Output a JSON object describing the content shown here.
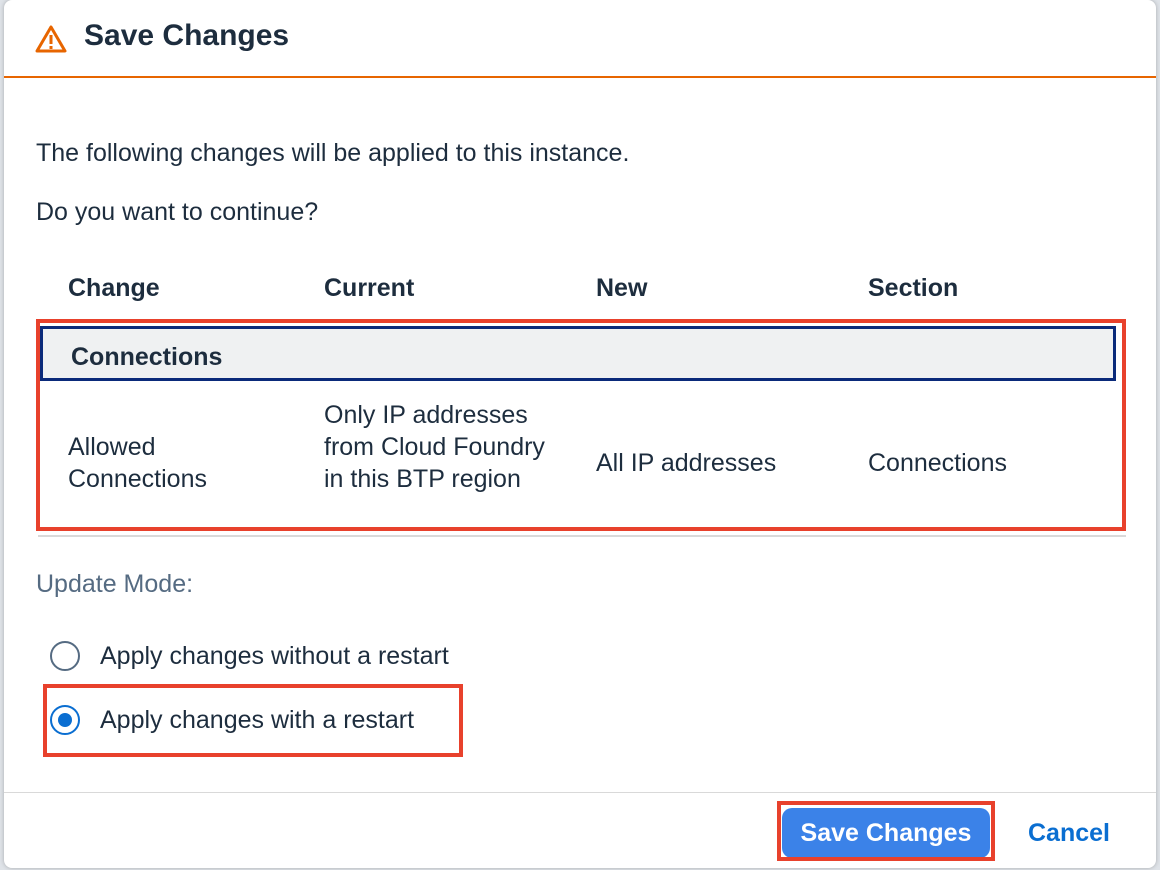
{
  "dialog": {
    "title": "Save Changes",
    "title_icon": "warning-triangle-icon",
    "accent_color": "#e76500",
    "message_line1": "The following changes will be applied to this instance.",
    "message_line2": "Do you want to continue?"
  },
  "table": {
    "columns": [
      "Change",
      "Current",
      "New",
      "Section"
    ],
    "group_label": "Connections",
    "rows": [
      {
        "change": "Allowed Connections",
        "current": "Only IP addresses from Cloud Foundry in this BTP region",
        "new": "All IP addresses",
        "section": "Connections"
      }
    ]
  },
  "update_mode": {
    "label": "Update Mode:",
    "options": [
      {
        "label": "Apply changes without a restart",
        "selected": false
      },
      {
        "label": "Apply changes with a restart",
        "selected": true
      }
    ]
  },
  "footer": {
    "save_label": "Save Changes",
    "cancel_label": "Cancel",
    "primary_color": "#3b82e8"
  },
  "highlight_color": "#e8412c"
}
